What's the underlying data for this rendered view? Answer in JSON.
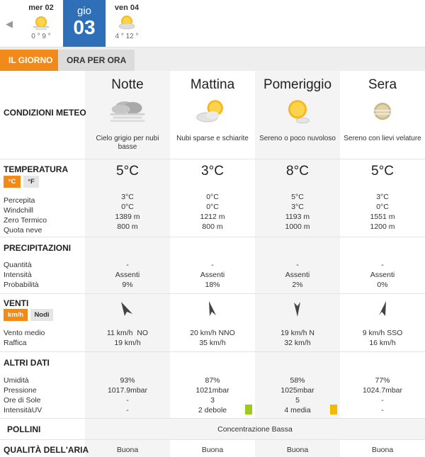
{
  "days": [
    {
      "name": "mer 02",
      "temps": "0 ° 9 °",
      "icon": "sun-haze-icon"
    },
    {
      "name": "gio",
      "number": "03"
    },
    {
      "name": "ven 04",
      "temps": "4 ° 12 °",
      "icon": "sun-cloud-icon"
    }
  ],
  "tabs": {
    "day": "IL GIORNO",
    "hourly": "ORA PER ORA"
  },
  "periods": [
    "Notte",
    "Mattina",
    "Pomeriggio",
    "Sera"
  ],
  "conditions": {
    "label": "CONDIZIONI METEO",
    "items": [
      {
        "icon": "overcast-fog-icon",
        "text": "Cielo grigio per nubi basse"
      },
      {
        "icon": "partly-cloudy-icon",
        "text": "Nubi sparse e schiarite"
      },
      {
        "icon": "sun-small-cloud-icon",
        "text": "Sereno o poco nuvoloso"
      },
      {
        "icon": "moon-veiled-icon",
        "text": "Sereno con lievi velature"
      }
    ]
  },
  "temperature": {
    "label": "TEMPERATURA",
    "unit_c": "°C",
    "unit_f": "°F",
    "sublabels": [
      "Percepita",
      "Windchill",
      "Zero Termico",
      "Quota neve"
    ],
    "values": [
      {
        "main": "5°C",
        "details": [
          "3°C",
          "0°C",
          "1389 m",
          "800 m"
        ]
      },
      {
        "main": "3°C",
        "details": [
          "0°C",
          "0°C",
          "1212 m",
          "800 m"
        ]
      },
      {
        "main": "8°C",
        "details": [
          "5°C",
          "3°C",
          "1193 m",
          "1000 m"
        ]
      },
      {
        "main": "5°C",
        "details": [
          "3°C",
          "0°C",
          "1551 m",
          "1200 m"
        ]
      }
    ]
  },
  "precipitation": {
    "label": "PRECIPITAZIONI",
    "sublabels": [
      "Quantità",
      "Intensità",
      "Probabilità"
    ],
    "values": [
      [
        "-",
        "Assenti",
        "9%"
      ],
      [
        "-",
        "Assenti",
        "18%"
      ],
      [
        "-",
        "Assenti",
        "2%"
      ],
      [
        "-",
        "Assenti",
        "0%"
      ]
    ]
  },
  "wind": {
    "label": "VENTI",
    "unit_kmh": "km/h",
    "unit_knots": "Nodi",
    "sublabels": [
      "Vento medio",
      "Raffica"
    ],
    "values": [
      {
        "arrow": "wind-arrow-nw-icon",
        "speed": "11 km/h  NO",
        "gust": "19 km/h"
      },
      {
        "arrow": "wind-arrow-nnw-icon",
        "speed": "20 km/h NNO",
        "gust": "35 km/h"
      },
      {
        "arrow": "wind-arrow-n-icon",
        "speed": "19 km/h N",
        "gust": "32 km/h"
      },
      {
        "arrow": "wind-arrow-sso-icon",
        "speed": "9 km/h SSO",
        "gust": "16 km/h"
      }
    ]
  },
  "other": {
    "label": "ALTRI DATI",
    "sublabels": [
      "Umidità",
      "Pressione",
      "Ore di Sole",
      "IntensitàUV"
    ],
    "values": [
      [
        "93%",
        "1017.9mbar",
        "-",
        "-"
      ],
      [
        "87%",
        "1021mbar",
        "3",
        "2 debole"
      ],
      [
        "58%",
        "1025mbar",
        "5",
        "4 media"
      ],
      [
        "77%",
        "1024.7mbar",
        "-",
        "-"
      ]
    ],
    "uv_colors": [
      "",
      "#9ccb1b",
      "#f5b800",
      ""
    ]
  },
  "pollen": {
    "label": "POLLINI",
    "value": "Concentrazione Bassa"
  },
  "air": {
    "label": "QUALITÀ DELL'ARIA",
    "values": [
      "Buona",
      "Buona",
      "Buona",
      "Buona"
    ]
  },
  "colors": {
    "accent": "#f28a1a",
    "day_active": "#2f6fb7",
    "col_shade": "#f4f4f4"
  }
}
